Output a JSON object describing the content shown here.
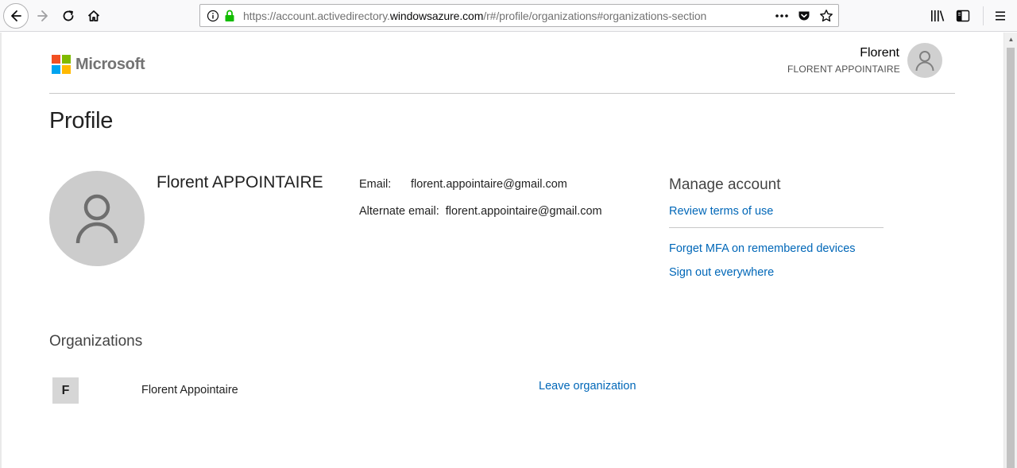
{
  "browser": {
    "url_prefix": "https://account.activedirectory.",
    "url_domain": "windowsazure.com",
    "url_path": "/r#/profile/organizations#organizations-section",
    "icons": {
      "back": "back-arrow-icon",
      "forward": "forward-arrow-icon",
      "reload": "reload-icon",
      "home": "home-icon",
      "info": "info-icon",
      "lock": "lock-icon",
      "more": "more-dots-icon",
      "pocket": "pocket-icon",
      "bookmark": "star-icon",
      "library": "library-icon",
      "sidebar": "sidebar-icon",
      "menu": "hamburger-menu-icon"
    }
  },
  "header": {
    "brand": "Microsoft",
    "brand_colors": [
      "#f25022",
      "#7fba00",
      "#00a4ef",
      "#ffb900"
    ],
    "user_first_name": "Florent",
    "user_full_upper": "FLORENT APPOINTAIRE"
  },
  "profile": {
    "title": "Profile",
    "full_name": "Florent APPOINTAIRE",
    "email_label": "Email:",
    "email_value": "florent.appointaire@gmail.com",
    "alt_email_label": "Alternate email:",
    "alt_email_value": "florent.appointaire@gmail.com"
  },
  "manage_account": {
    "heading": "Manage account",
    "links": {
      "terms": "Review terms of use",
      "mfa": "Forget MFA on remembered devices",
      "signout": "Sign out everywhere"
    },
    "link_color": "#0067b8"
  },
  "organizations": {
    "heading": "Organizations",
    "items": [
      {
        "initial": "F",
        "name": "Florent Appointaire",
        "action": "Leave organization"
      }
    ]
  }
}
